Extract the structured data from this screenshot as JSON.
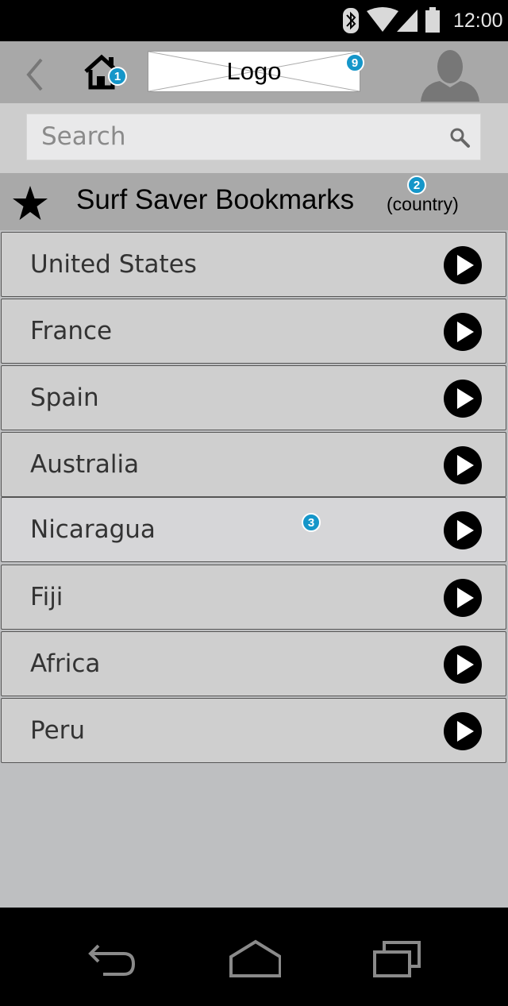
{
  "status_bar": {
    "time": "12:00",
    "icons": [
      "bluetooth-icon",
      "wifi-icon",
      "signal-icon",
      "battery-icon"
    ]
  },
  "top_bar": {
    "logo_text": "Logo",
    "badges": {
      "home": "1",
      "logo": "9"
    },
    "icons": [
      "back-chevron-icon",
      "home-icon",
      "user-avatar-icon"
    ]
  },
  "search": {
    "placeholder": "Search",
    "icon": "search-icon"
  },
  "section": {
    "title": "Surf Saver Bookmarks",
    "subtitle": "(country)",
    "badge": "2",
    "icon": "star-icon"
  },
  "list": {
    "badge": "3",
    "items": [
      {
        "label": "United States"
      },
      {
        "label": "France"
      },
      {
        "label": "Spain"
      },
      {
        "label": "Australia"
      },
      {
        "label": "Nicaragua"
      },
      {
        "label": "Fiji"
      },
      {
        "label": "Africa"
      },
      {
        "label": "Peru"
      }
    ]
  },
  "nav_bar": {
    "icons": [
      "back-icon",
      "home-icon",
      "recents-icon"
    ]
  },
  "colors": {
    "badge": "#1596c9",
    "top_bar": "#a8a8a8",
    "list_bg": "#bebfc1",
    "item_bg": "#cfcfcf"
  }
}
